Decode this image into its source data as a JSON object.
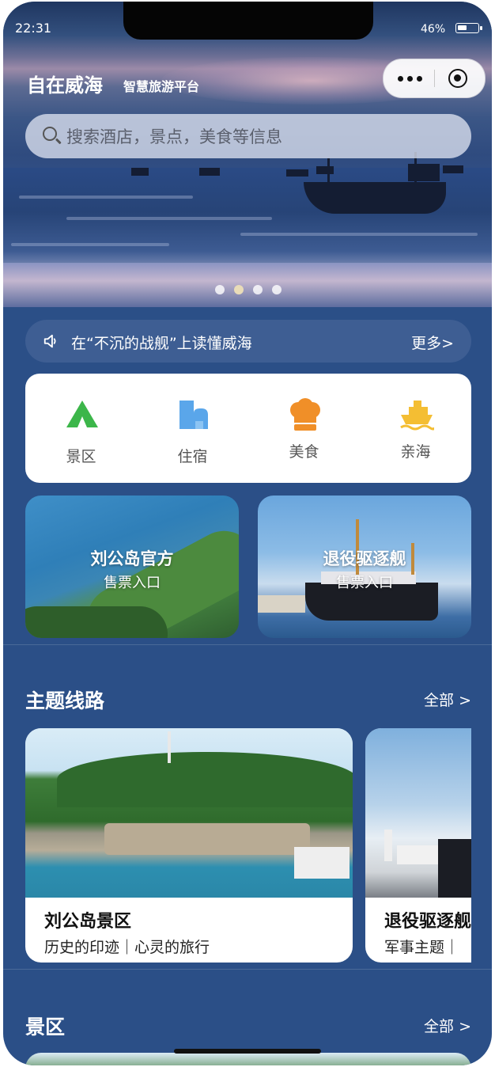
{
  "status_bar": {
    "time": "22:31",
    "battery": "46%",
    "battery_level": 0.46
  },
  "header": {
    "title": "自在威海",
    "subtitle": "智慧旅游平台"
  },
  "capsule": {
    "more_icon": "more-dots-icon",
    "close_icon": "target-circle-icon"
  },
  "search": {
    "placeholder": "搜索酒店，景点，美食等信息",
    "icon": "search-icon"
  },
  "carousel": {
    "page_count": 4,
    "active_index": 1
  },
  "notice": {
    "icon": "speaker-icon",
    "text": "在“不沉的战舰”上读懂威海",
    "more_label": "更多>"
  },
  "quick_nav": {
    "items": [
      {
        "label": "景区",
        "icon": "tent-icon",
        "color": "#3cb64a"
      },
      {
        "label": "住宿",
        "icon": "building-icon",
        "color": "#5aa6ea"
      },
      {
        "label": "美食",
        "icon": "chef-hat-icon",
        "color": "#f08f28"
      },
      {
        "label": "亲海",
        "icon": "ship-icon",
        "color": "#f4be33"
      }
    ]
  },
  "promo_cards": [
    {
      "title": "刘公岛官方",
      "subtitle": "售票入口"
    },
    {
      "title": "退役驱逐舰",
      "subtitle": "售票入口"
    }
  ],
  "theme_routes": {
    "title": "主题线路",
    "all_label": "全部 >",
    "items": [
      {
        "name": "刘公岛景区",
        "desc": "历史的印迹｜心灵的旅行"
      },
      {
        "name": "退役驱逐舰",
        "desc": "军事主题｜"
      }
    ]
  },
  "scenic": {
    "title": "景区",
    "all_label": "全部 >"
  },
  "colors": {
    "page_bg": "#2b4f87",
    "notice_bg": "#3e5e93",
    "card_bg": "#ffffff"
  }
}
